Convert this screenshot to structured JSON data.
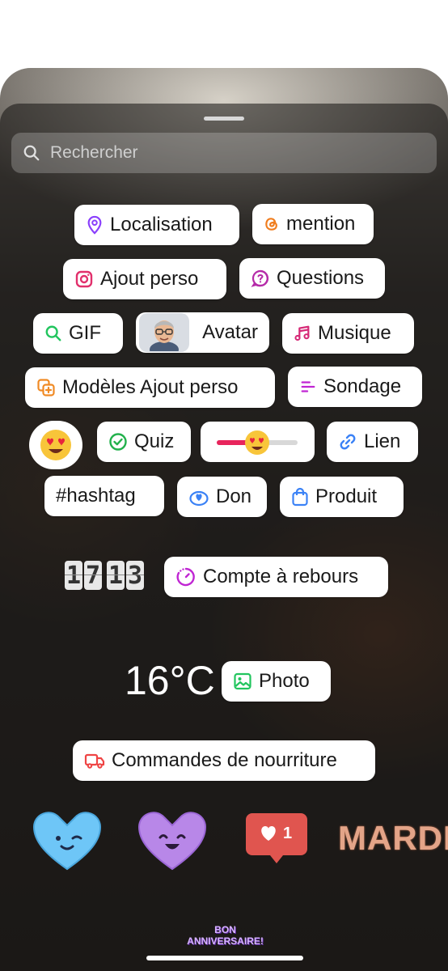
{
  "search": {
    "placeholder": "Rechercher"
  },
  "stickers": {
    "localisation": "Localisation",
    "mention": "mention",
    "ajout_perso": "Ajout perso",
    "questions": "Questions",
    "gif": "GIF",
    "avatar": "Avatar",
    "musique": "Musique",
    "modeles": "Modèles Ajout perso",
    "sondage": "Sondage",
    "quiz": "Quiz",
    "lien": "Lien",
    "hashtag": "#hashtag",
    "don": "Don",
    "produit": "Produit",
    "compte": "Compte à rebours",
    "photo": "Photo",
    "commandes": "Commandes de nourriture"
  },
  "clock": {
    "h1": "1",
    "h2": "7",
    "m1": "1",
    "m2": "3"
  },
  "temperature": "16°C",
  "like_count": "1",
  "mardi": "MARDI",
  "bon_anniversaire": {
    "line1": "BON",
    "line2": "ANNIVERSAIRE!"
  },
  "slider": {
    "level": 0.35
  },
  "colors": {
    "location": "#8a3ffc",
    "mention": "#f07d1e",
    "camera": "#e1306c",
    "questions": "#b52aa8",
    "gif": "#22c55e",
    "music": "#d62976",
    "templates": "#f08a24",
    "poll": "#c026d3",
    "quiz": "#22b14c",
    "link": "#3b82f6",
    "hashtag": "#c026d3",
    "donate": "#3b82f6",
    "product": "#3b82f6",
    "countdown": "#c026d3",
    "photo": "#22c55e",
    "food": "#ef4444",
    "heart_blue": "#6ec6f7",
    "heart_purple": "#b887e8",
    "like_red": "#e0554f"
  }
}
